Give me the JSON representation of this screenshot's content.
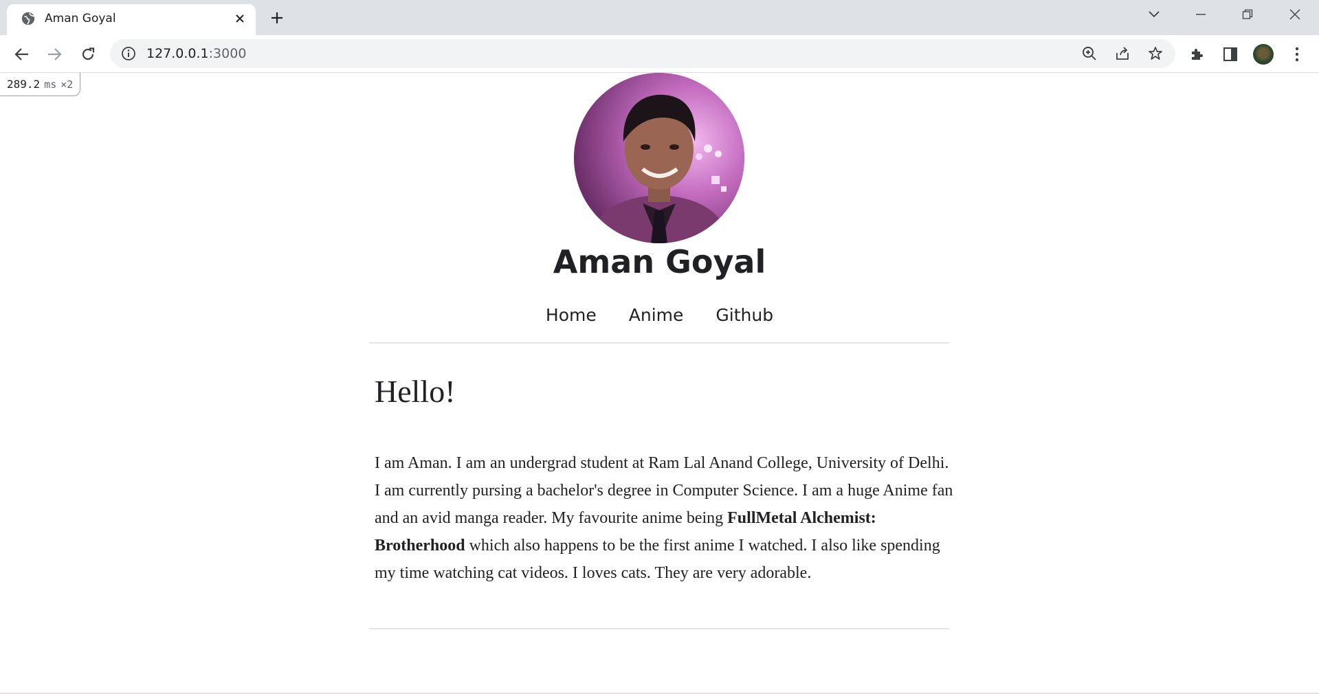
{
  "browser": {
    "tab_title": "Aman Goyal",
    "url_host": "127.0.0.1",
    "url_path": ":3000"
  },
  "perf": {
    "value": "289.2",
    "unit": "ms",
    "multiplier": "×2"
  },
  "page": {
    "site_title": "Aman Goyal",
    "nav": [
      "Home",
      "Anime",
      "Github"
    ],
    "heading": "Hello!",
    "bio_part1": "I am Aman. I am an undergrad student at Ram Lal Anand College, University of Delhi. I am currently pursing a bachelor's degree in Computer Science. I am a huge Anime fan and an avid manga reader. My favourite anime being ",
    "bio_bold": "FullMetal Alchemist: Brotherhood",
    "bio_part2": " which also happens to be the first anime I watched. I also like spending my time watching cat videos. I loves cats. They are very adorable."
  },
  "colors": {
    "tabstrip_bg": "#dee1e6",
    "omnibox_bg": "#f1f3f4",
    "text": "#202124"
  }
}
